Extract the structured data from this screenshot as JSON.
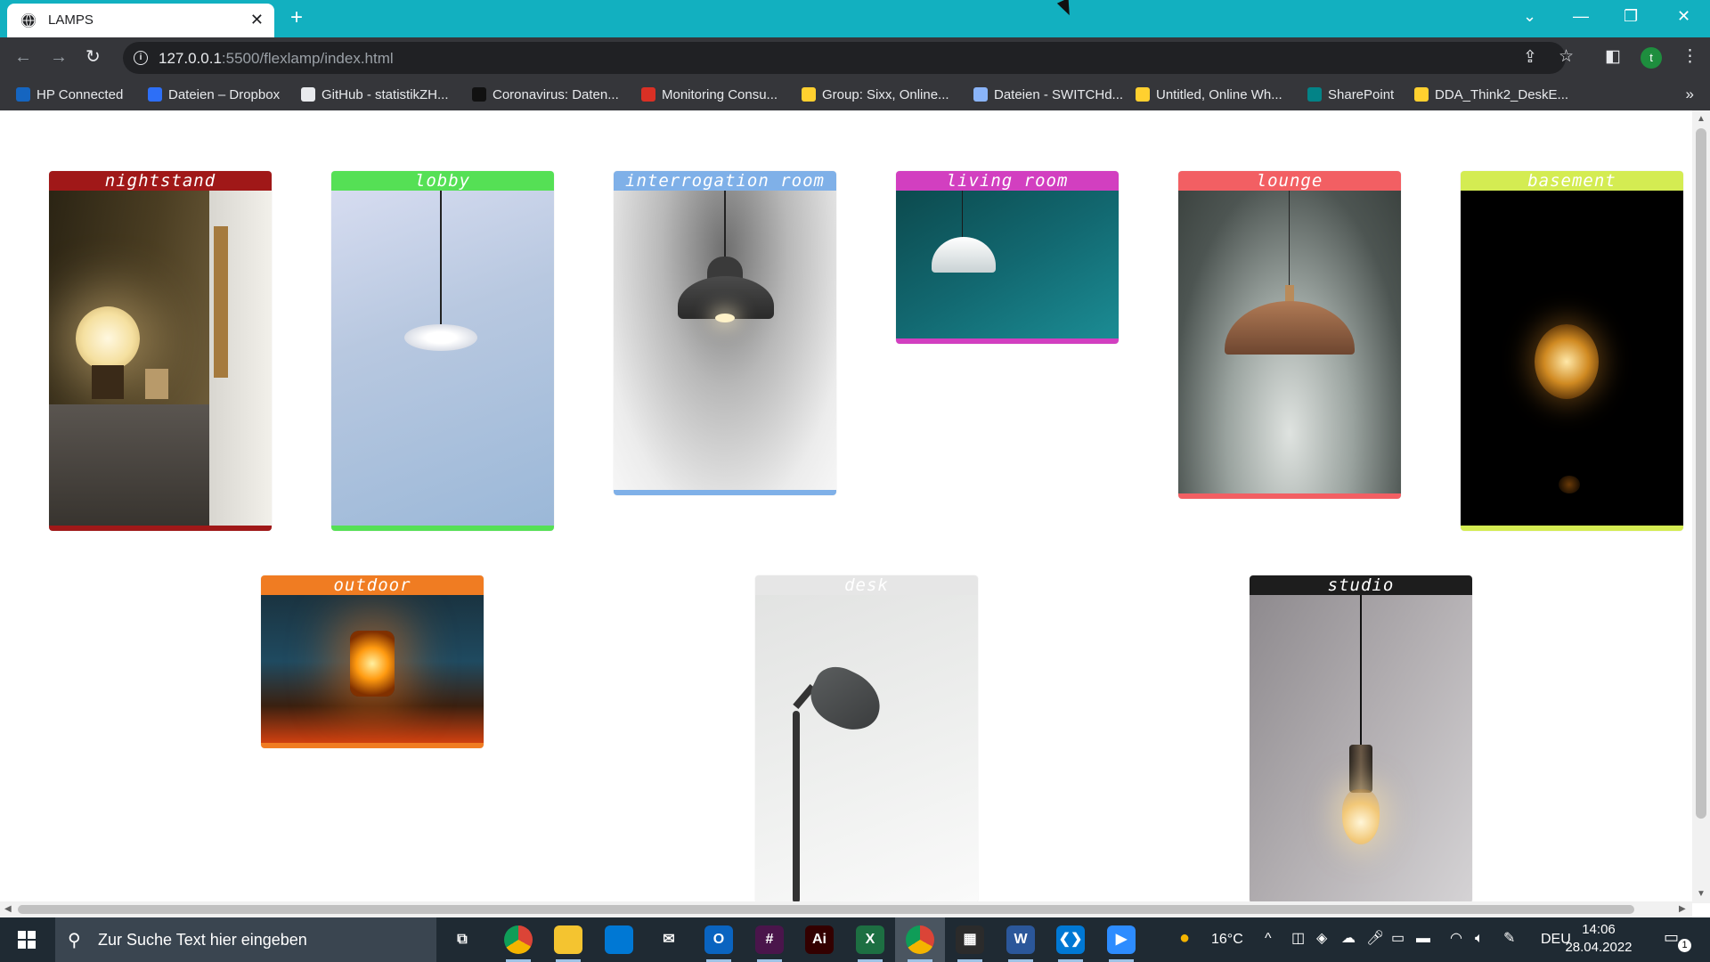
{
  "browser": {
    "tab_title": "LAMPS",
    "tab_close": "✕",
    "new_tab": "+",
    "url_host": "127.0.0.1",
    "url_path": ":5500/flexlamp/index.html",
    "profile_initial": "t",
    "window_controls": [
      "⌄",
      "—",
      "❐",
      "✕"
    ]
  },
  "bookmarks": [
    {
      "label": "HP Connected",
      "icon": "hp-icon",
      "color": "#1565c0"
    },
    {
      "label": "Dateien – Dropbox",
      "icon": "dropbox-icon",
      "color": "#2d6ff7"
    },
    {
      "label": "GitHub - statistikZH...",
      "icon": "github-icon",
      "color": "#e8eaed"
    },
    {
      "label": "Coronavirus: Daten...",
      "icon": "nzz-icon",
      "color": "#111111"
    },
    {
      "label": "Monitoring Consu...",
      "icon": "monitoring-icon",
      "color": "#d93025"
    },
    {
      "label": "Group: Sixx, Online...",
      "icon": "miro-icon",
      "color": "#ffd02f"
    },
    {
      "label": "Dateien - SWITCHd...",
      "icon": "switch-cloud-icon",
      "color": "#8ab4f8"
    },
    {
      "label": "Untitled, Online Wh...",
      "icon": "miro-icon",
      "color": "#ffd02f"
    },
    {
      "label": "SharePoint",
      "icon": "sharepoint-icon",
      "color": "#038387"
    },
    {
      "label": "DDA_Think2_DeskE...",
      "icon": "miro-icon",
      "color": "#ffd02f"
    }
  ],
  "bookmarks_more": "»",
  "cards": [
    {
      "label": "nightstand",
      "color": "#a01818"
    },
    {
      "label": "lobby",
      "color": "#55e055"
    },
    {
      "label": "interrogation room",
      "color": "#7fb0e8"
    },
    {
      "label": "living room",
      "color": "#d23fc0"
    },
    {
      "label": "lounge",
      "color": "#f25f63"
    },
    {
      "label": "basement",
      "color": "#d4ec52"
    },
    {
      "label": "outdoor",
      "color": "#f07c22"
    },
    {
      "label": "desk",
      "color": "#e6e6e6"
    },
    {
      "label": "studio",
      "color": "#1d1d1d"
    }
  ],
  "taskbar": {
    "search_placeholder": "Zur Suche Text hier eingeben",
    "weather": "16°C",
    "language": "DEU",
    "time": "14:06",
    "date": "28.04.2022",
    "notifications": "1",
    "apps": [
      {
        "name": "task-view",
        "glyph": "⧉",
        "color": "transparent"
      },
      {
        "name": "chrome",
        "glyph": "",
        "color": "#db4437"
      },
      {
        "name": "file-explorer",
        "glyph": "",
        "color": "#f4c430"
      },
      {
        "name": "store",
        "glyph": "",
        "color": "#0078d4"
      },
      {
        "name": "mail",
        "glyph": "✉",
        "color": "transparent"
      },
      {
        "name": "outlook",
        "glyph": "O",
        "color": "#0a64c0"
      },
      {
        "name": "slack",
        "glyph": "#",
        "color": "#4a154b"
      },
      {
        "name": "illustrator",
        "glyph": "Ai",
        "color": "#330000"
      },
      {
        "name": "excel",
        "glyph": "X",
        "color": "#1d6f42"
      },
      {
        "name": "chrome-profile",
        "glyph": "",
        "color": "#7b61ff"
      },
      {
        "name": "calculator",
        "glyph": "▦",
        "color": "#2b2b2b"
      },
      {
        "name": "word",
        "glyph": "W",
        "color": "#2b579a"
      },
      {
        "name": "vscode",
        "glyph": "❮❯",
        "color": "#0078d4"
      },
      {
        "name": "zoom",
        "glyph": "▶",
        "color": "#2d8cff"
      }
    ]
  }
}
